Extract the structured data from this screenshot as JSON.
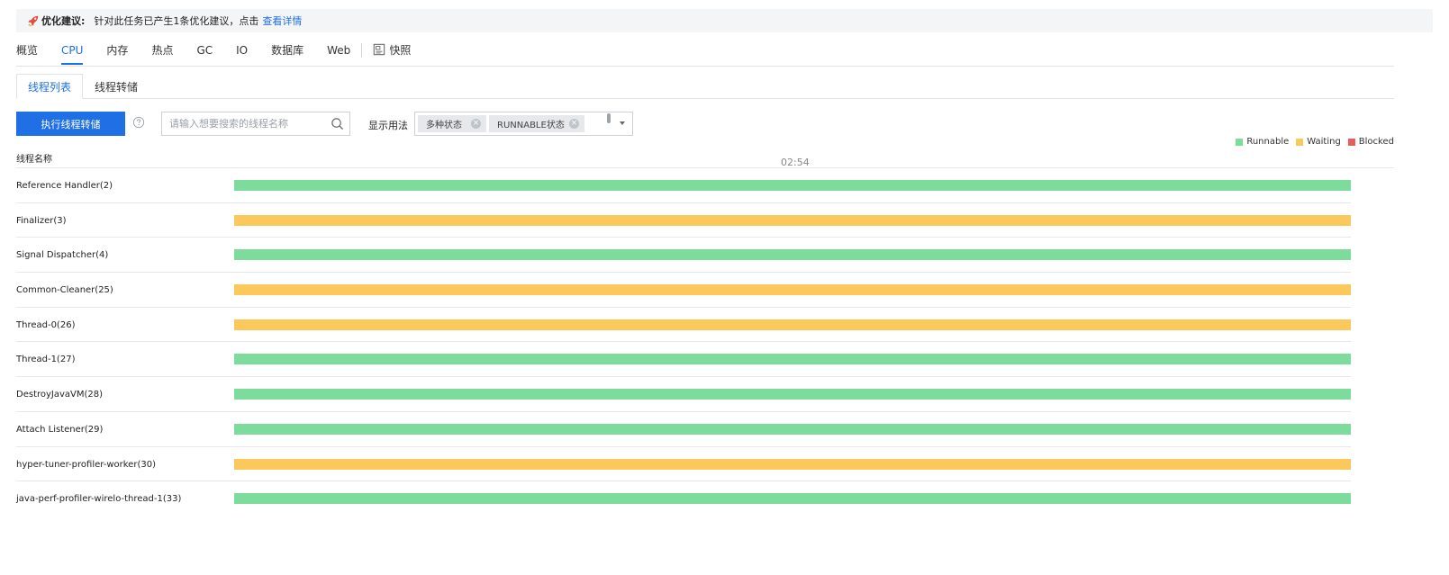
{
  "tip": {
    "prefix": "优化建议:",
    "message": "针对此任务已产生1条优化建议，点击",
    "link": "查看详情"
  },
  "main_tabs": [
    {
      "label": "概览",
      "active": false
    },
    {
      "label": "CPU",
      "active": true
    },
    {
      "label": "内存",
      "active": false
    },
    {
      "label": "热点",
      "active": false
    },
    {
      "label": "GC",
      "active": false
    },
    {
      "label": "IO",
      "active": false
    },
    {
      "label": "数据库",
      "active": false
    },
    {
      "label": "Web",
      "active": false
    }
  ],
  "snapshot_tab": {
    "label": "快照"
  },
  "sub_tabs": [
    {
      "label": "线程列表",
      "active": true
    },
    {
      "label": "线程转储",
      "active": false
    }
  ],
  "toolbar": {
    "run_label": "执行线程转储",
    "search_placeholder": "请输入想要搜索的线程名称",
    "display_label": "显示用法",
    "chips": [
      "多种状态",
      "RUNNABLE状态"
    ]
  },
  "legend": [
    {
      "label": "Runnable",
      "color": "#7ddc9c"
    },
    {
      "label": "Waiting",
      "color": "#fbc85c"
    },
    {
      "label": "Blocked",
      "color": "#ea5d5d"
    }
  ],
  "table": {
    "column_header": "线程名称",
    "time_label": "02:54",
    "rows": [
      {
        "name": "Reference Handler(2)",
        "state": "Runnable"
      },
      {
        "name": "Finalizer(3)",
        "state": "Waiting"
      },
      {
        "name": "Signal Dispatcher(4)",
        "state": "Runnable"
      },
      {
        "name": "Common-Cleaner(25)",
        "state": "Waiting"
      },
      {
        "name": "Thread-0(26)",
        "state": "Waiting"
      },
      {
        "name": "Thread-1(27)",
        "state": "Runnable"
      },
      {
        "name": "DestroyJavaVM(28)",
        "state": "Runnable"
      },
      {
        "name": "Attach Listener(29)",
        "state": "Runnable"
      },
      {
        "name": "hyper-tuner-profiler-worker(30)",
        "state": "Waiting"
      },
      {
        "name": "java-perf-profiler-wirelo-thread-1(33)",
        "state": "Runnable"
      }
    ]
  },
  "colors": {
    "accent": "#1f6fe5",
    "runnable": "#7ddc9c",
    "waiting": "#fbc85c",
    "blocked": "#ea5d5d"
  }
}
